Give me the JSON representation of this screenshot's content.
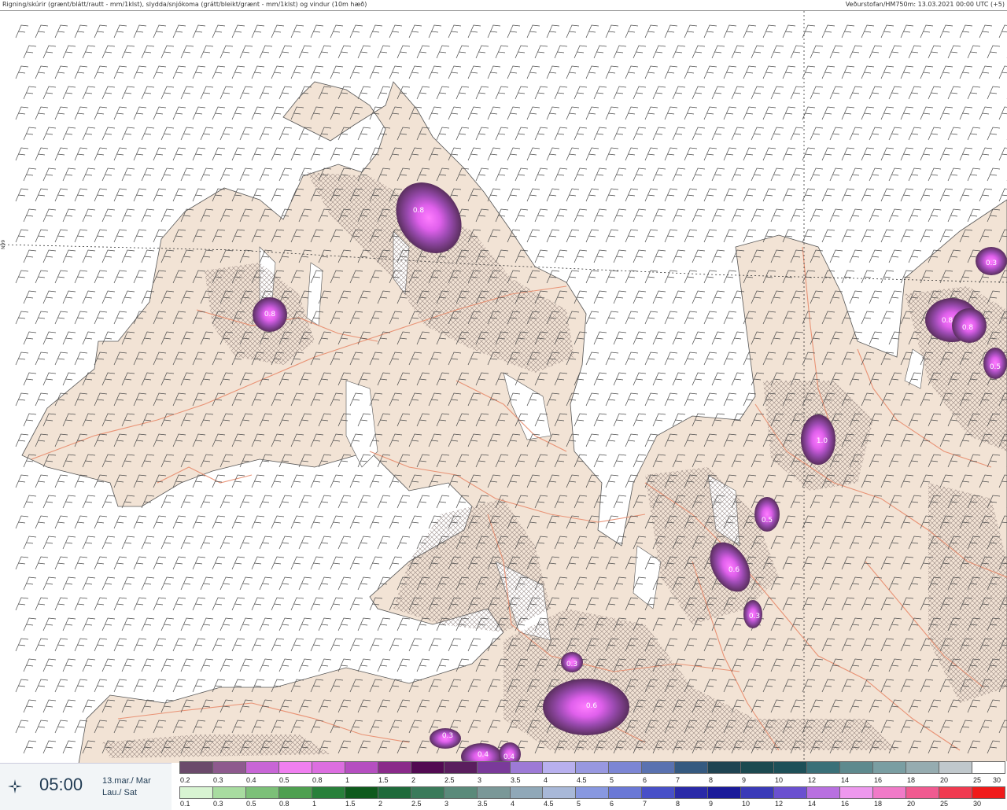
{
  "header": {
    "title": "Rigning/skúrir (grænt/blátt/rautt - mm/1klst), slydda/snjókoma (grátt/bleikt/grænt - mm/1klst) og vindur (10m hæð)",
    "source": "Veðurstofan/HM750m: 13.03.2021 00:00 UTC (+5)"
  },
  "map": {
    "lat_label": "N99",
    "land_color": "#f2e3d5",
    "sea_color": "#ffffff",
    "road_color": "#e8896a",
    "precip_labels": [
      {
        "value": "0.8"
      },
      {
        "value": "0.8"
      },
      {
        "value": "0.3"
      },
      {
        "value": "0.8"
      },
      {
        "value": "0.8"
      },
      {
        "value": "0.5"
      },
      {
        "value": "1.0"
      },
      {
        "value": "0.5"
      },
      {
        "value": "0.6"
      },
      {
        "value": "0.3"
      },
      {
        "value": "0.3"
      },
      {
        "value": "0.6"
      },
      {
        "value": "0.3"
      },
      {
        "value": "0.4"
      },
      {
        "value": "0.4"
      },
      {
        "value": "0.3"
      }
    ]
  },
  "timebox": {
    "icon": "wind-compass-icon",
    "time": "05:00",
    "date_line1": "13.mar./ Mar",
    "date_line2": "Lau./ Sat"
  },
  "legend": {
    "snow": {
      "colors": [
        "#6b4a6b",
        "#8e5a8e",
        "#c866d6",
        "#f07ff0",
        "#dc6ee0",
        "#b54fc0",
        "#8a2a8a",
        "#520a52",
        "#5a1e5e",
        "#7a3a9a",
        "#9d7ad6",
        "#b8b0ee",
        "#9898e0",
        "#7c86d4",
        "#5a72b0",
        "#355a80",
        "#1f4452",
        "#1c4a50",
        "#1e5058",
        "#3a7078",
        "#5e8a8e",
        "#7a9ea2",
        "#96acb0",
        "#c0c8cc",
        "#ffffff"
      ],
      "labels": [
        "0.2",
        "0.3",
        "0.4",
        "0.5",
        "0.8",
        "1",
        "1.5",
        "2",
        "2.5",
        "3",
        "3.5",
        "4",
        "4.5",
        "5",
        "6",
        "7",
        "8",
        "9",
        "10",
        "12",
        "14",
        "16",
        "18",
        "20",
        "25",
        "30"
      ]
    },
    "rain": {
      "colors": [
        "#d8f4d2",
        "#a8dca0",
        "#7cc078",
        "#4ea050",
        "#28803a",
        "#0e5a1c",
        "#1e6a3a",
        "#3a7a5a",
        "#5a8a7a",
        "#7a9898",
        "#90a8b8",
        "#a8b8d8",
        "#8898e0",
        "#6a78d6",
        "#4850c8",
        "#2a2aa8",
        "#1a1a9a",
        "#3a3ab8",
        "#6a50d0",
        "#b870e0",
        "#ee98ee",
        "#f07ac8",
        "#f05a90",
        "#f03a50",
        "#f01a1a"
      ],
      "labels": [
        "0.1",
        "0.3",
        "0.5",
        "0.8",
        "1",
        "1.5",
        "2",
        "2.5",
        "3",
        "3.5",
        "4",
        "4.5",
        "5",
        "6",
        "7",
        "8",
        "9",
        "10",
        "12",
        "14",
        "16",
        "18",
        "20",
        "25",
        "30"
      ]
    }
  }
}
